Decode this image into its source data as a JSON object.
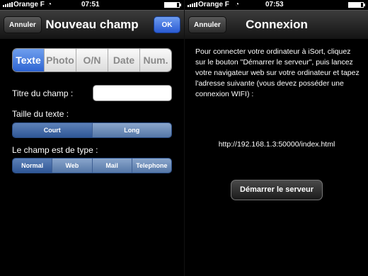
{
  "left": {
    "status": {
      "carrier": "Orange F",
      "time": "07:51"
    },
    "nav": {
      "cancel": "Annuler",
      "title": "Nouveau champ",
      "ok": "OK"
    },
    "type_tabs": [
      "Texte",
      "Photo",
      "O/N",
      "Date",
      "Num."
    ],
    "type_tabs_selected": "Texte",
    "field_title_label": "Titre du champ :",
    "field_title_value": "",
    "text_size_label": "Taille du texte :",
    "text_size_options": [
      "Court",
      "Long"
    ],
    "text_size_selected": "Court",
    "field_kind_label": "Le champ est de type :",
    "field_kind_options": [
      "Normal",
      "Web",
      "Mail",
      "Telephone"
    ],
    "field_kind_selected": "Normal"
  },
  "right": {
    "status": {
      "carrier": "Orange F",
      "time": "07:53"
    },
    "nav": {
      "cancel": "Annuler",
      "title": "Connexion"
    },
    "instructions": "Pour connecter votre ordinateur à iSort, cliquez sur le bouton \"Démarrer le serveur\", puis lancez votre navigateur web sur votre ordinateur et tapez l'adresse suivante (vous devez posséder une connexion WIFI) :",
    "url": "http://192.168.1.3:50000/index.html",
    "start_button": "Démarrer le serveur"
  },
  "colors": {
    "accent_blue": "#2e64d2",
    "segment_blue": "#5577a7",
    "background": "#000000"
  },
  "icons": [
    "signal-icon",
    "wifi-icon",
    "battery-icon"
  ]
}
